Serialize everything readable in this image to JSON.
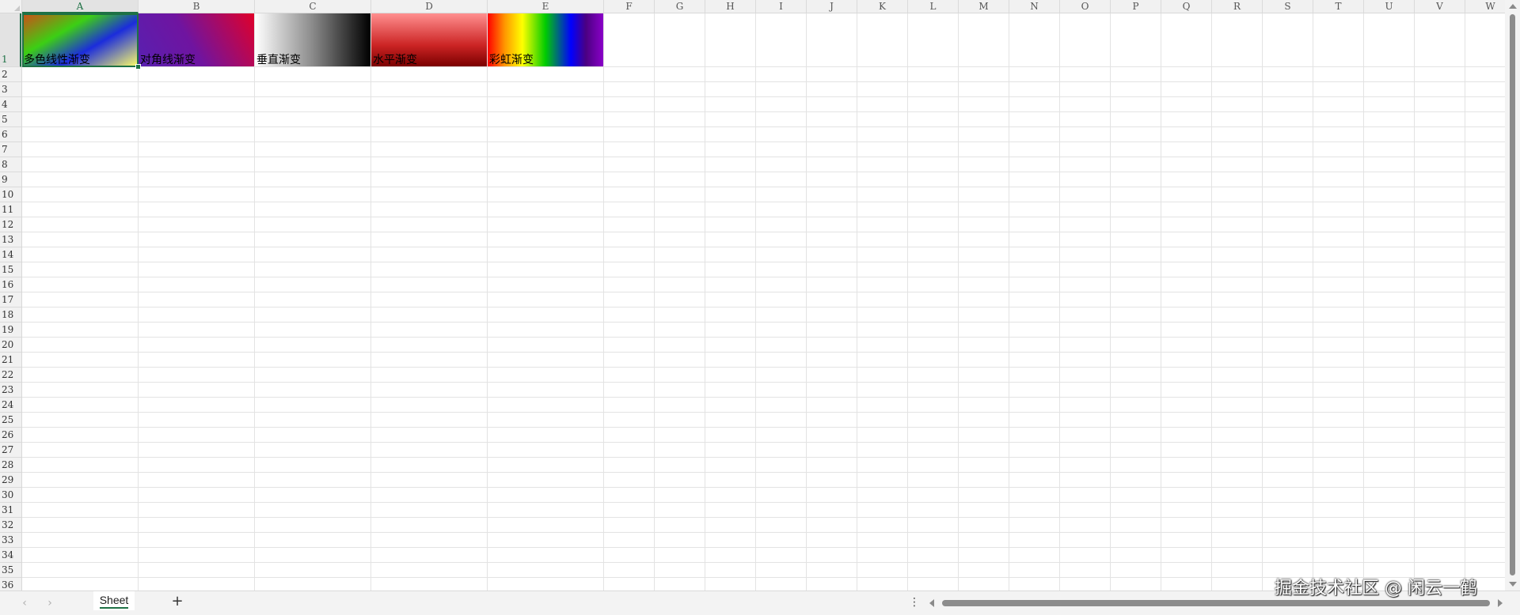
{
  "columns": [
    "A",
    "B",
    "C",
    "D",
    "E",
    "F",
    "G",
    "H",
    "I",
    "J",
    "K",
    "L",
    "M",
    "N",
    "O",
    "P",
    "Q",
    "R",
    "S",
    "T",
    "U",
    "V",
    "W"
  ],
  "rows": [
    "1",
    "2",
    "3",
    "4",
    "5",
    "6",
    "7",
    "8",
    "9",
    "10",
    "11",
    "12",
    "13",
    "14",
    "15",
    "16",
    "17",
    "18",
    "19",
    "20",
    "21",
    "22",
    "23",
    "24",
    "25",
    "26",
    "27",
    "28",
    "29",
    "30",
    "31",
    "32",
    "33",
    "34",
    "35",
    "36"
  ],
  "active_cell": "A1",
  "cells": [
    {
      "col": "A",
      "text": "多色线性渐变",
      "gradient": "linear-gradient(150deg,#d24b17 0%,#3ccf14 35%,#1b2cdc 62%,#ffff66 100%)"
    },
    {
      "col": "B",
      "text": "对角线渐变",
      "gradient": "linear-gradient(60deg,#5820b0 0%,#6f14a0 45%,#e0002a 100%)"
    },
    {
      "col": "C",
      "text": "垂直渐变",
      "gradient": "linear-gradient(90deg,#ffffff 0%,#8a8a8a 50%,#000000 100%)"
    },
    {
      "col": "D",
      "text": "水平渐变",
      "gradient": "linear-gradient(180deg,#ff8f8f 0%,#cc2424 60%,#7a0000 100%)"
    },
    {
      "col": "E",
      "text": "彩虹渐变",
      "gradient": "linear-gradient(90deg,#ff0000 0%,#ff9900 15%,#ffff00 30%,#00cc00 50%,#0000ff 72%,#4b0082 85%,#8a00c8 100%)"
    }
  ],
  "sheet_tab": {
    "label": "Sheet"
  },
  "add_sheet_label": "+",
  "more_label": "⋮",
  "nav": {
    "prev": "‹",
    "next": "›"
  },
  "watermark": "掘金技术社区 @ 闲云一鹤",
  "colors": {
    "accent": "#1e7145",
    "header_bg": "#f1f1f1",
    "gridline": "#e3e3e3"
  }
}
